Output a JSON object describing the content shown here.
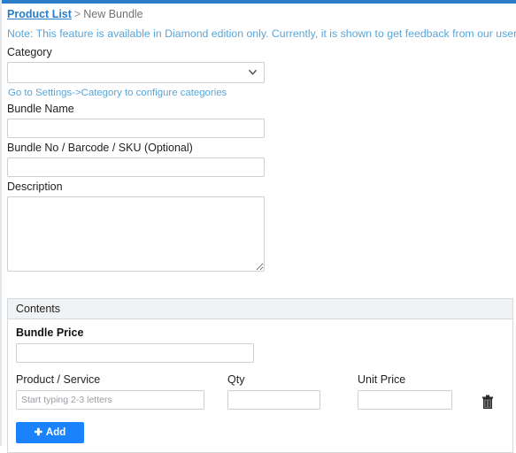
{
  "page": {
    "accent_color": "#2a7cc7",
    "note_color": "#5aa5d8",
    "button_color": "#1a82fb"
  },
  "breadcrumb": {
    "link_label": "Product List",
    "separator": ">",
    "current_label": "New Bundle"
  },
  "note": {
    "text": "Note: This feature is available in Diamond edition only. Currently, it is shown to get feedback from our users."
  },
  "form": {
    "category": {
      "label": "Category",
      "value": "",
      "options": [
        ""
      ],
      "chevron_icon": "chevron-down-icon",
      "help_text": "Go to Settings->Category to configure categories"
    },
    "bundle_name": {
      "label": "Bundle Name",
      "value": "",
      "placeholder": ""
    },
    "bundle_no": {
      "label": "Bundle No / Barcode / SKU (Optional)",
      "value": "",
      "placeholder": ""
    },
    "description": {
      "label": "Description",
      "value": "",
      "placeholder": ""
    }
  },
  "contents_panel": {
    "title": "Contents",
    "bundle_price": {
      "label": "Bundle Price",
      "value": "",
      "placeholder": ""
    },
    "line_item_headers": {
      "product": "Product / Service",
      "qty": "Qty",
      "unit_price": "Unit Price"
    },
    "line_items": [
      {
        "product_value": "",
        "product_placeholder": "Start typing 2-3 letters",
        "qty_value": "",
        "qty_placeholder": "",
        "unit_price_value": "",
        "unit_price_placeholder": "",
        "delete_icon": "trash-icon"
      }
    ],
    "add_button": {
      "label": "Add",
      "icon": "plus-icon"
    }
  }
}
